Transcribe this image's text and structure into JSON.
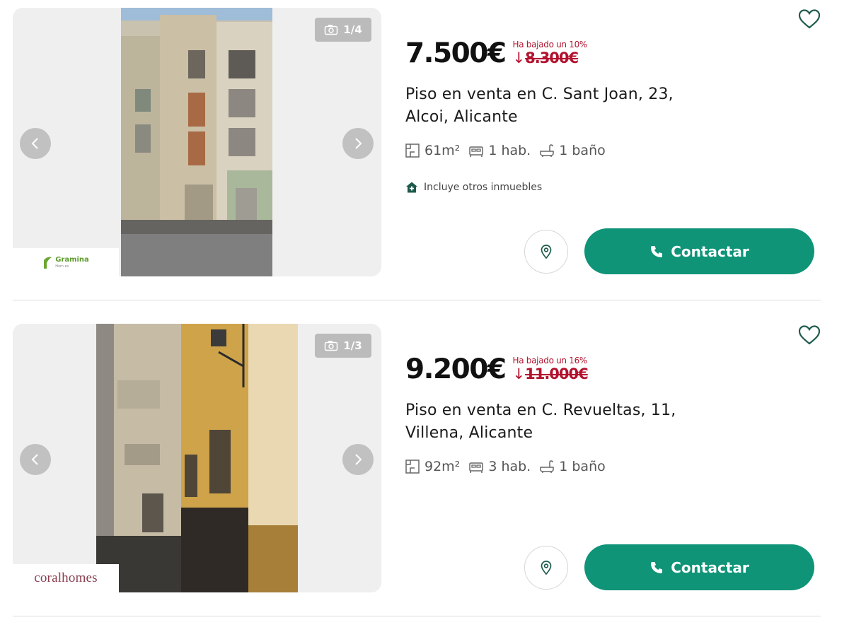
{
  "colors": {
    "accent": "#0f9478",
    "price_drop": "#b3122e",
    "text": "#1a1a1a",
    "muted": "#555555"
  },
  "listings": [
    {
      "photo_counter": "1/4",
      "agency_logo": "Gramina",
      "agency_logo_sub": "Hom es",
      "price": "7.500€",
      "drop_note": "Ha bajado un 10%",
      "old_price_arrow": "↓",
      "old_price": "8.300€",
      "title": "Piso en venta en C. Sant Joan, 23, Alcoi, Alicante",
      "area": "61m²",
      "rooms": "1 hab.",
      "baths": "1 baño",
      "extra_note": "Incluye otros inmuebles",
      "contact_label": "Contactar"
    },
    {
      "photo_counter": "1/3",
      "agency_logo": "coralhomes",
      "price": "9.200€",
      "drop_note": "Ha bajado un 16%",
      "old_price_arrow": "↓",
      "old_price": "11.000€",
      "title": "Piso en venta en C. Revueltas, 11, Villena, Alicante",
      "area": "92m²",
      "rooms": "3 hab.",
      "baths": "1 baño",
      "contact_label": "Contactar"
    }
  ]
}
